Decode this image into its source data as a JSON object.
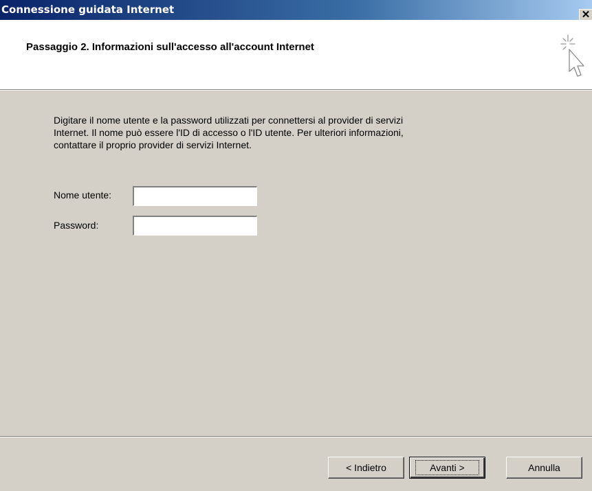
{
  "window": {
    "title": "Connessione guidata Internet",
    "close_glyph": "✕"
  },
  "header": {
    "heading": "Passaggio 2. Informazioni sull'accesso all'account Internet",
    "icon": "wizard-cursor-icon"
  },
  "body": {
    "description": "Digitare il nome utente e la password utilizzati per connettersi al provider di servizi\nInternet. Il nome può essere l'ID di accesso o l'ID utente. Per ulteriori informazioni,\ncontattare il proprio provider di servizi Internet.",
    "username": {
      "label": "Nome utente:",
      "value": ""
    },
    "password": {
      "label": "Password:",
      "value": ""
    }
  },
  "buttons": {
    "back": "< Indietro",
    "next": "Avanti >",
    "cancel": "Annulla"
  }
}
